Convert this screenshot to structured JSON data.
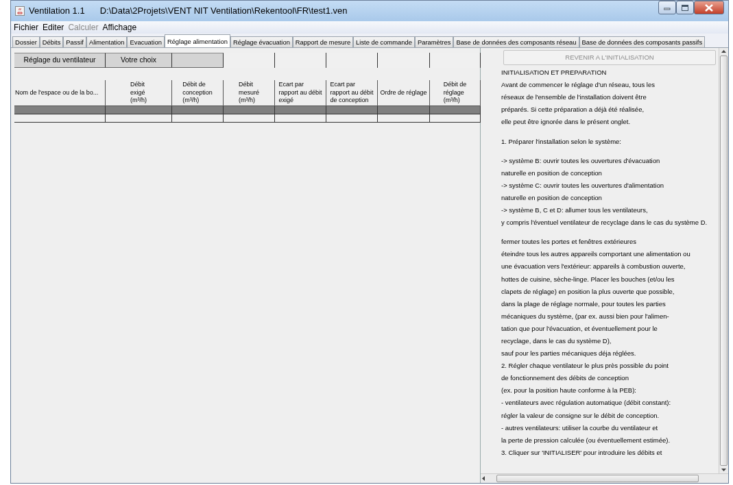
{
  "window": {
    "title": "Ventilation 1.1",
    "path": "D:\\Data\\2Projets\\VENT NIT Ventilation\\Rekentool\\FR\\test1.ven"
  },
  "menu": [
    {
      "label": "Fichier",
      "disabled": false
    },
    {
      "label": "Editer",
      "disabled": false
    },
    {
      "label": "Calculer",
      "disabled": true
    },
    {
      "label": "Affichage",
      "disabled": false
    }
  ],
  "tabs": [
    {
      "label": "Dossier",
      "selected": false
    },
    {
      "label": "Débits",
      "selected": false
    },
    {
      "label": "Passif",
      "selected": false
    },
    {
      "label": "Alimentation",
      "selected": false
    },
    {
      "label": "Evacuation",
      "selected": false
    },
    {
      "label": "Réglage alimentation",
      "selected": true
    },
    {
      "label": "Réglage évacuation",
      "selected": false
    },
    {
      "label": "Rapport de mesure",
      "selected": false
    },
    {
      "label": "Liste de commande",
      "selected": false
    },
    {
      "label": "Paramètres",
      "selected": false
    },
    {
      "label": "Base de données des composants réseau",
      "selected": false
    },
    {
      "label": "Base de données des composants passifs",
      "selected": false
    }
  ],
  "fan_row": [
    {
      "label": "Réglage du ventilateur",
      "kind": "header"
    },
    {
      "label": "Votre choix",
      "kind": "header"
    },
    {
      "kind": "header"
    },
    {
      "kind": "empty"
    },
    {
      "kind": "empty"
    },
    {
      "kind": "empty"
    },
    {
      "kind": "empty"
    },
    {
      "kind": "empty"
    }
  ],
  "table": {
    "columns": [
      "Nom de l'espace ou de la bo...",
      "Débit\nexigé\n(m³/h)",
      "Débit de\nconception\n(m³/h)",
      "Débit\nmesuré\n(m³/h)",
      "Ecart par\nrapport au débit\nexigé",
      "Ecart par\nrapport au débit\nde conception",
      "Ordre de réglage",
      "Débit de\nréglage\n(m³/h)"
    ],
    "rows": [
      {
        "selected": true
      },
      {
        "selected": false
      }
    ]
  },
  "side_panel": {
    "button": {
      "label": "REVENIR A L'INITIALISATION",
      "disabled": true
    },
    "paragraphs": [
      [
        "INITIALISATION ET PREPARATION",
        "Avant de commencer le réglage d'un réseau, tous les",
        "réseaux de l'ensemble de l'installation doivent être",
        "préparés. Si cette préparation a déjà été réalisée,",
        "elle peut être ignorée dans le présent onglet."
      ],
      [
        "1. Préparer l'installation selon le système:"
      ],
      [
        "-> système B: ouvrir toutes les ouvertures d'évacuation",
        "naturelle en position de conception",
        "-> système C: ouvrir toutes les ouvertures d'alimentation",
        "naturelle en position de conception",
        "-> système B, C et D: allumer tous les ventilateurs,",
        "y compris l'éventuel ventilateur de recyclage dans le cas du système D."
      ],
      [
        "fermer toutes les portes et fenêtres extérieures",
        "éteindre tous les autres appareils comportant une alimentation ou",
        "une évacuation vers l'extérieur: appareils à combustion ouverte,",
        "hottes de cuisine, sèche-linge. Placer les bouches (et/ou les",
        "clapets de réglage) en position la plus ouverte que possible,",
        "dans la plage de réglage normale, pour toutes les parties",
        "mécaniques du système, (par ex. aussi bien pour l'alimen-",
        "tation que pour l'évacuation, et éventuellement pour le",
        "recyclage, dans le cas du système D),",
        "sauf pour les parties mécaniques déja réglées.",
        "2. Régler chaque ventilateur le plus près possible du point",
        "de fonctionnement des débits de conception",
        "(ex. pour la position haute conforme à la PEB):",
        "- ventilateurs avec régulation automatique (débit constant):",
        "régler la valeur de consigne sur le débit de conception.",
        "- autres ventilateurs: utiliser la courbe du ventilateur et",
        "la perte de pression calculée (ou éventuellement estimée).",
        "3. Cliquer sur 'INITIALISER' pour introduire les débits et"
      ]
    ]
  }
}
